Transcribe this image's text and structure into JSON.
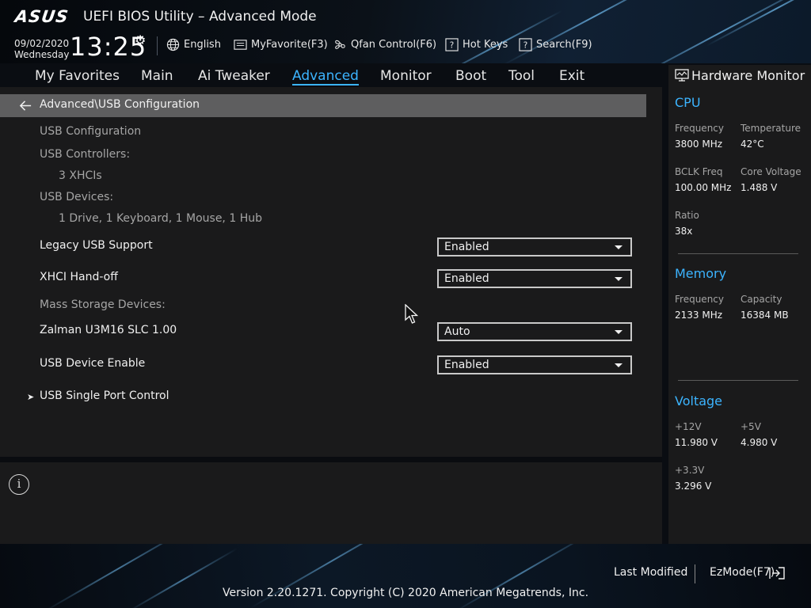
{
  "header": {
    "logo": "ASUS",
    "title": "UEFI BIOS Utility – Advanced Mode",
    "date": "09/02/2020",
    "weekday": "Wednesday",
    "time": "13:25",
    "tools": [
      {
        "label": "English",
        "icon": "globe-icon"
      },
      {
        "label": "MyFavorite(F3)",
        "icon": "favorite-icon"
      },
      {
        "label": "Qfan Control(F6)",
        "icon": "fan-icon"
      },
      {
        "label": "Hot Keys",
        "icon": "help-box-icon"
      },
      {
        "label": "Search(F9)",
        "icon": "help-box-icon"
      }
    ]
  },
  "nav": {
    "tabs": [
      "My Favorites",
      "Main",
      "Ai Tweaker",
      "Advanced",
      "Monitor",
      "Boot",
      "Tool",
      "Exit"
    ],
    "active": "Advanced"
  },
  "breadcrumb": "Advanced\\USB Configuration",
  "content": {
    "section_title": "USB Configuration",
    "controllers_label": "USB Controllers:",
    "controllers_value": "3 XHCIs",
    "devices_label": "USB Devices:",
    "devices_value": "1 Drive, 1 Keyboard, 1 Mouse, 1 Hub",
    "legacy_label": "Legacy USB Support",
    "legacy_value": "Enabled",
    "xhci_label": "XHCI Hand-off",
    "xhci_value": "Enabled",
    "mass_storage_label": "Mass Storage Devices:",
    "zalman_label": "Zalman U3M16 SLC 1.00",
    "zalman_value": "Auto",
    "usb_enable_label": "USB Device Enable",
    "usb_enable_value": "Enabled",
    "single_port_label": "USB Single Port Control"
  },
  "hw_monitor": {
    "title": "Hardware Monitor",
    "cpu": {
      "title": "CPU",
      "frequency_label": "Frequency",
      "frequency_value": "3800 MHz",
      "temperature_label": "Temperature",
      "temperature_value": "42°C",
      "bclk_label": "BCLK Freq",
      "bclk_value": "100.00 MHz",
      "core_voltage_label": "Core Voltage",
      "core_voltage_value": "1.488 V",
      "ratio_label": "Ratio",
      "ratio_value": "38x"
    },
    "memory": {
      "title": "Memory",
      "frequency_label": "Frequency",
      "frequency_value": "2133 MHz",
      "capacity_label": "Capacity",
      "capacity_value": "16384 MB"
    },
    "voltage": {
      "title": "Voltage",
      "v12_label": "+12V",
      "v12_value": "11.980 V",
      "v5_label": "+5V",
      "v5_value": "4.980 V",
      "v33_label": "+3.3V",
      "v33_value": "3.296 V"
    }
  },
  "footer": {
    "last_modified": "Last Modified",
    "ezmode": "EzMode(F7)",
    "copyright": "Version 2.20.1271. Copyright (C) 2020 American Megatrends, Inc."
  },
  "colors": {
    "accent": "#3cb4ff",
    "panel": "#1a1a1b",
    "breadcrumb": "#5e5e5f"
  }
}
